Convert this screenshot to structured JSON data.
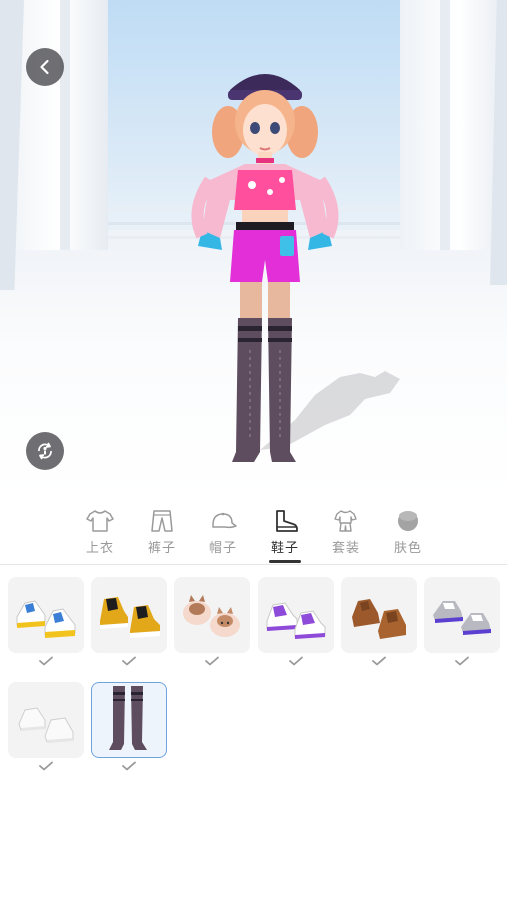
{
  "colors": {
    "accent_selected": "#6fa3de",
    "tab_active": "#333333",
    "tab_inactive": "#999999",
    "button_bg": "#46464b"
  },
  "header": {
    "back_icon": "chevron-left-icon",
    "rotate_icon": "rotate-view-icon"
  },
  "tabs": [
    {
      "label": "上衣",
      "icon": "shirt-icon"
    },
    {
      "label": "裤子",
      "icon": "pants-icon"
    },
    {
      "label": "帽子",
      "icon": "cap-icon"
    },
    {
      "label": "鞋子",
      "icon": "boot-icon",
      "active": true
    },
    {
      "label": "套装",
      "icon": "outfit-icon"
    },
    {
      "label": "肤色",
      "icon": "skin-color-icon"
    }
  ],
  "items": [
    {
      "name": "white-blue-yellow-sneakers",
      "owned": true
    },
    {
      "name": "black-yellow-high-tops",
      "owned": true
    },
    {
      "name": "cat-slippers",
      "owned": true
    },
    {
      "name": "purple-white-sneakers",
      "owned": true
    },
    {
      "name": "brown-leather-shoes",
      "owned": true
    },
    {
      "name": "gray-purple-running-shoes",
      "owned": true
    },
    {
      "name": "white-loafers",
      "owned": true
    },
    {
      "name": "thigh-high-boots",
      "owned": true,
      "selected": true
    }
  ]
}
